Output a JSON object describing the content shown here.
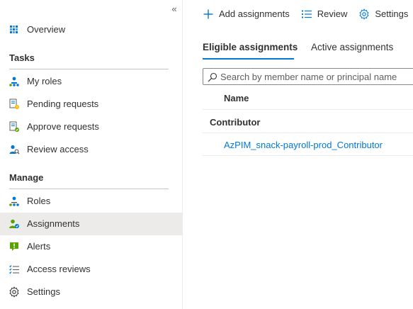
{
  "sidebar": {
    "collapse_glyph": "«",
    "overview": {
      "label": "Overview",
      "icon": "overview-grid-icon"
    },
    "sections": {
      "tasks": "Tasks",
      "manage": "Manage"
    },
    "tasks_items": [
      {
        "label": "My roles",
        "icon": "my-roles-icon"
      },
      {
        "label": "Pending requests",
        "icon": "pending-requests-icon"
      },
      {
        "label": "Approve requests",
        "icon": "approve-requests-icon"
      },
      {
        "label": "Review access",
        "icon": "review-access-icon"
      }
    ],
    "manage_items": [
      {
        "label": "Roles",
        "icon": "roles-icon"
      },
      {
        "label": "Assignments",
        "icon": "assignments-icon",
        "active": true
      },
      {
        "label": "Alerts",
        "icon": "alerts-icon"
      },
      {
        "label": "Access reviews",
        "icon": "access-reviews-icon"
      },
      {
        "label": "Settings",
        "icon": "gear-icon"
      }
    ]
  },
  "toolbar": {
    "add_label": "Add assignments",
    "review_label": "Review",
    "settings_label": "Settings"
  },
  "tabs": [
    {
      "label": "Eligible assignments",
      "active": true
    },
    {
      "label": "Active assignments",
      "active": false
    }
  ],
  "search": {
    "placeholder": "Search by member name or principal name",
    "value": ""
  },
  "grid": {
    "columns": [
      "Name"
    ],
    "groups": [
      {
        "name": "Contributor",
        "rows": [
          "AzPIM_snack-payroll-prod_Contributor"
        ]
      }
    ]
  },
  "colors": {
    "accent": "#0078d4",
    "active_nav_bg": "#edebe9",
    "alert_green": "#57a300",
    "people_blue": "#0078d4",
    "people_green": "#57a300"
  }
}
